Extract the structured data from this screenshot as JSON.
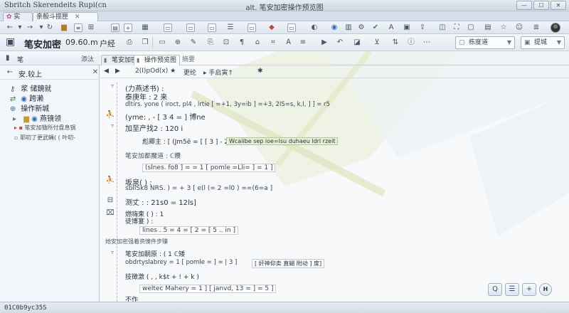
{
  "window": {
    "app_name": "Sbritch Skerendeits Rupi(cn",
    "title": "alt. 笔安加密操作预览图",
    "controls": [
      "—",
      "☐",
      "✕"
    ]
  },
  "tabs": [
    {
      "label": "实"
    },
    {
      "label": "亲般斗揽匣"
    }
  ],
  "toolbar": {
    "doc_title": "笔安加密",
    "doc_size": "09.60.m",
    "doc_label2": "户经",
    "dropdown1": "栋度道",
    "dropdown2": "提城"
  },
  "left_panel": {
    "header": "笔",
    "header_right": "添汰",
    "nav_label": "安.较上",
    "nav_close": "✕",
    "items": [
      {
        "icon": "key-icon",
        "label": "浆 储鏡就"
      },
      {
        "icon": "arrow-icon",
        "label": "跨濑"
      },
      {
        "icon": "globe-icon",
        "label": "操作新城"
      },
      {
        "icon": "folder-icon",
        "label": "燕镜领"
      }
    ],
    "sub_items": [
      "笔安加锄所付盘息锅",
      "耶叨了更武蝇( ( 叶叨-"
    ]
  },
  "editor": {
    "tabs": [
      {
        "label": "笔安加密"
      },
      {
        "label": "操作预览图"
      },
      {
        "label": "摘要"
      }
    ],
    "toolbar_items": [
      "◀",
      "▶",
      "2(I)pOd(x) ★",
      "更纶",
      "▸ 手启寅↑",
      "✱"
    ],
    "rows": [
      {
        "text": "(力燕述书) :"
      },
      {
        "text": "泰庚年 : 2 来"
      },
      {
        "text": "dltirs.  yone (  iroct,  pl4 ,  lrtie  [ =+1,  3y=ib ]  =+3,  2lS=s,  k,I,  ] ]  = r5"
      },
      {
        "text": "(yme: ,  -  [ 3 4 = ] 博ne"
      },
      {
        "text": "加至产找2 : 120 i"
      },
      {
        "text": "彪卿主 : [ (Jm5ẽ = [ [ 3 ] - 2 =  1"
      },
      {
        "text": "Wcaiibe sep  ioe=lsu  duhaeu  ldrl  rzeit"
      },
      {
        "text": "笔安加都魔道 : ℂ孇"
      },
      {
        "text": "(slnes.  fo8 ] = = 1  [  pomle =Lli= ]  = 1 ]"
      },
      {
        "text": "坂泉( ) :"
      },
      {
        "text": "sbllSk8 NRS. ) = + 3  [  e(l (=  2 =l0 ) ==(6=a ]"
      },
      {
        "text": "测丈 : : 21s0  =  12ls]"
      },
      {
        "text": "燃嗨柬 ( ) :  1"
      },
      {
        "text": "徒博宴 ) :"
      },
      {
        "text": "lines .  5 = 4 = [ 2 = [ 5 ..   in ]"
      },
      {
        "text": "她安加密强着资懊件步赚"
      },
      {
        "text": "笔安加嗣原 : ( 1 ℂ矮"
      },
      {
        "text": "obdrtyslabrey   = 1  [  pomle = ]  = |  3 ]"
      },
      {
        "text": "[ 奸神仰卖 直蝴 附动 ] 度]"
      },
      {
        "text": "技徴激 ( ,  , k$t + ! + k )"
      },
      {
        "text": "weltec Mahery  = 1 ]  [ janvd, 13 = ]  = 5 ]"
      },
      {
        "text": "不作"
      }
    ]
  },
  "floating_buttons": [
    "Q",
    "☰",
    "+",
    "H"
  ],
  "status": "01C0b9yc35S"
}
